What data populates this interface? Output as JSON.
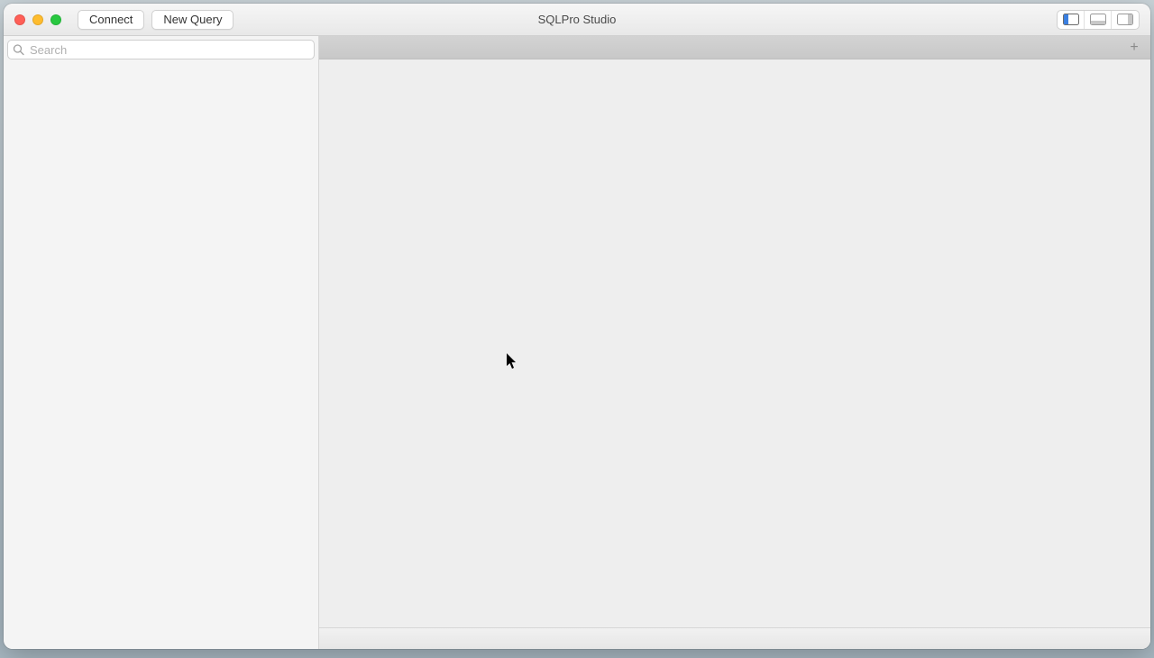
{
  "window": {
    "title": "SQLPro Studio"
  },
  "toolbar": {
    "connect_label": "Connect",
    "new_query_label": "New Query"
  },
  "sidebar": {
    "search_placeholder": "Search"
  },
  "tabbar": {
    "add_label": "+"
  },
  "view_toggles": {
    "left_panel": "left",
    "bottom_panel": "bottom",
    "right_panel": "right"
  }
}
